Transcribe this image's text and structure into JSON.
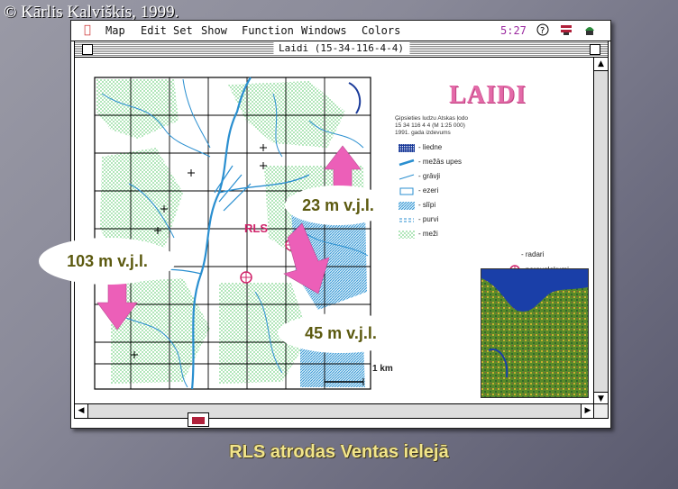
{
  "copyright": "© Kārlis Kalviškis, 1999.",
  "menubar": {
    "items": [
      "Map",
      "Edit",
      "Set",
      "Show",
      "Function",
      "Windows",
      "Colors"
    ],
    "clock": "5:27"
  },
  "window": {
    "title": "Laidi (15-34-116-4-4)"
  },
  "map": {
    "heading": "LAIDI",
    "description": [
      "Ģipsieties ludzu Atskas ļodo",
      "15 34 116 4 4 (M 1:25 000)",
      "1991. gada izdevums"
    ],
    "legend": [
      {
        "label": "- liedne",
        "icon": "dense-hatch"
      },
      {
        "label": "- mežās upes",
        "icon": "thick-blue-line"
      },
      {
        "label": "- grāvji",
        "icon": "thin-blue-line"
      },
      {
        "label": "- ezeri",
        "icon": "blue-outline"
      },
      {
        "label": "- slīpi",
        "icon": "hatch-blue"
      },
      {
        "label": "- purvi",
        "icon": "dashed-blue"
      },
      {
        "label": "- meži",
        "icon": "green-dots"
      }
    ],
    "legend_right": [
      {
        "label": "- radari",
        "icon": "radar-symbol"
      },
      {
        "label": "- paraugļakumi",
        "icon": "cross-symbol"
      }
    ],
    "rls_label": "RLS",
    "scale_label": "1 km",
    "callouts": [
      "23 m v.j.l.",
      "103 m v.j.l.",
      "45 m v.j.l."
    ]
  },
  "colors": {
    "accent_pink": "#ec5fb8",
    "water_blue": "#2a8fd0",
    "forest_green": "#7bd48a",
    "title_pink": "#e36aa8"
  },
  "caption": "RLS atrodas Ventas ielejā"
}
